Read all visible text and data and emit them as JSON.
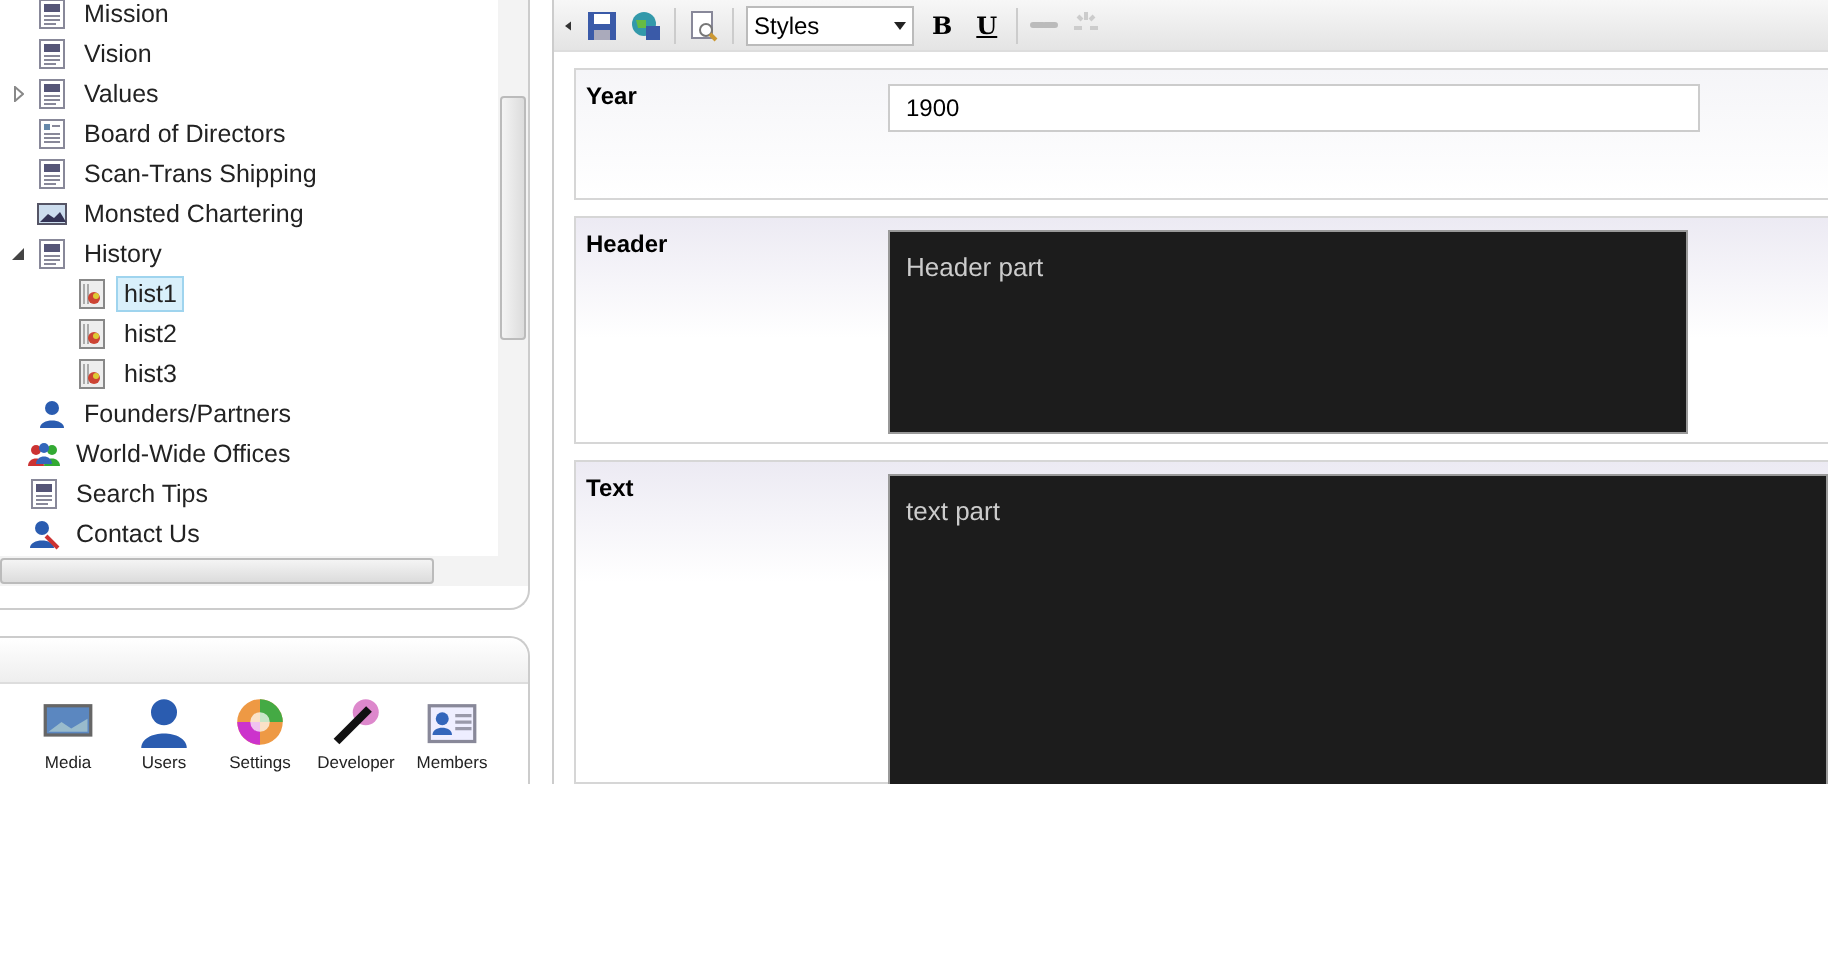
{
  "tree": {
    "inner_items": [
      {
        "label": "Mission",
        "selected": false
      },
      {
        "label": "Vision",
        "selected": false
      },
      {
        "label": "Values",
        "selected": false,
        "expanded": false
      },
      {
        "label": "Board of Directors",
        "selected": false
      },
      {
        "label": "Scan-Trans Shipping",
        "selected": false
      },
      {
        "label": "Monsted Chartering",
        "selected": false
      },
      {
        "label": "History",
        "selected": false,
        "expanded": true,
        "children": [
          {
            "label": "hist1",
            "selected": true
          },
          {
            "label": "hist2",
            "selected": false
          },
          {
            "label": "hist3",
            "selected": false
          }
        ]
      },
      {
        "label": "Founders/Partners",
        "selected": false
      }
    ],
    "outer_items": [
      {
        "label": "World-Wide Offices",
        "selected": false
      },
      {
        "label": "Search Tips",
        "selected": false
      },
      {
        "label": "Contact Us",
        "selected": false
      }
    ]
  },
  "sections": [
    {
      "label": "Media"
    },
    {
      "label": "Users"
    },
    {
      "label": "Settings"
    },
    {
      "label": "Developer"
    },
    {
      "label": "Members"
    }
  ],
  "toolbar": {
    "styles": "Styles",
    "bold": "B",
    "underline": "U"
  },
  "fields": [
    {
      "label": "Year",
      "kind": "text",
      "value": "1900"
    },
    {
      "label": "Header",
      "kind": "rich",
      "value": "Header part"
    },
    {
      "label": "Text",
      "kind": "rich",
      "value": "text part"
    }
  ]
}
